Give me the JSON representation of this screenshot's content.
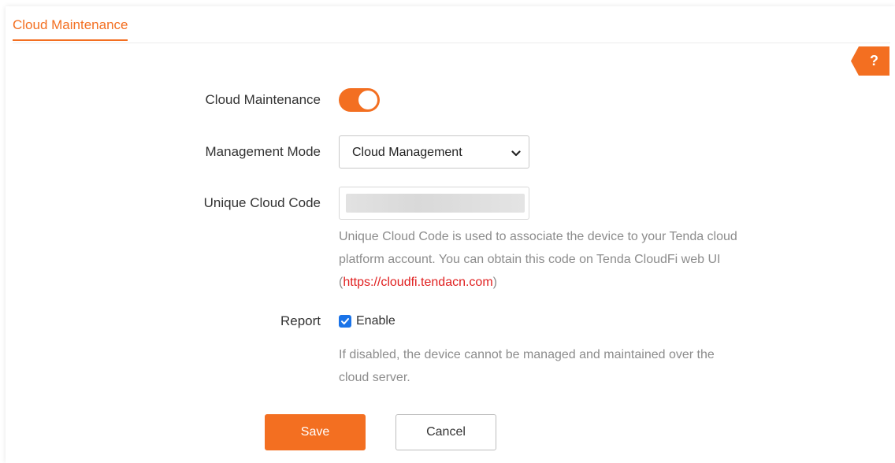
{
  "tab": {
    "title": "Cloud Maintenance"
  },
  "help": {
    "icon": "question-icon",
    "glyph": "?"
  },
  "colors": {
    "accent": "#f36f21",
    "link": "#e02020",
    "checkbox": "#1a73e8"
  },
  "form": {
    "cloud_maintenance": {
      "label": "Cloud Maintenance",
      "enabled": true
    },
    "management_mode": {
      "label": "Management Mode",
      "selected": "Cloud Management"
    },
    "unique_cloud_code": {
      "label": "Unique Cloud Code",
      "value_blurred": true,
      "hint_line1": "Unique Cloud Code is used to associate the device to your Tenda cloud",
      "hint_line2": "platform account. You can obtain this code on Tenda CloudFi web UI",
      "hint_open": "(",
      "hint_link": "https://cloudfi.tendacn.com",
      "hint_close": ")"
    },
    "report": {
      "label": "Report",
      "checkbox_label": "Enable",
      "checked": true,
      "hint_line1": "If disabled, the device cannot be managed and maintained over the",
      "hint_line2": "cloud server."
    }
  },
  "buttons": {
    "save": "Save",
    "cancel": "Cancel"
  }
}
